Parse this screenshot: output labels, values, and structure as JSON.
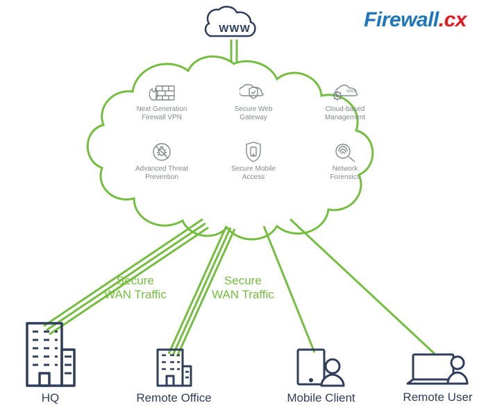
{
  "brand": {
    "left": "Firewall",
    "right": ".cx"
  },
  "internet": {
    "label": "WWW"
  },
  "cloud_features": [
    {
      "name": "ngfw",
      "label": "Next Generation\nFirewall VPN",
      "icon": "firewall-icon"
    },
    {
      "name": "swg",
      "label": "Secure Web\nGateway",
      "icon": "shield-cloud-icon"
    },
    {
      "name": "mgmt",
      "label": "Cloud-based\nManagement",
      "icon": "gear-cloud-icon"
    },
    {
      "name": "atp",
      "label": "Advanced Threat\nPrevention",
      "icon": "no-bug-icon"
    },
    {
      "name": "sma",
      "label": "Secure Mobile\nAccess",
      "icon": "mobile-shield-icon"
    },
    {
      "name": "forensics",
      "label": "Network\nForensics",
      "icon": "fingerprint-icon"
    }
  ],
  "wan": {
    "left": "Secure\nWAN Traffic",
    "right": "Secure\nWAN Traffic"
  },
  "endpoints": {
    "hq": {
      "label": "HQ"
    },
    "office": {
      "label": "Remote Office"
    },
    "mobile": {
      "label": "Mobile Client"
    },
    "user": {
      "label": "Remote User"
    }
  },
  "colors": {
    "accent": "#74be3f",
    "outline": "#2f3d5c",
    "muted": "#7f8b8a"
  }
}
